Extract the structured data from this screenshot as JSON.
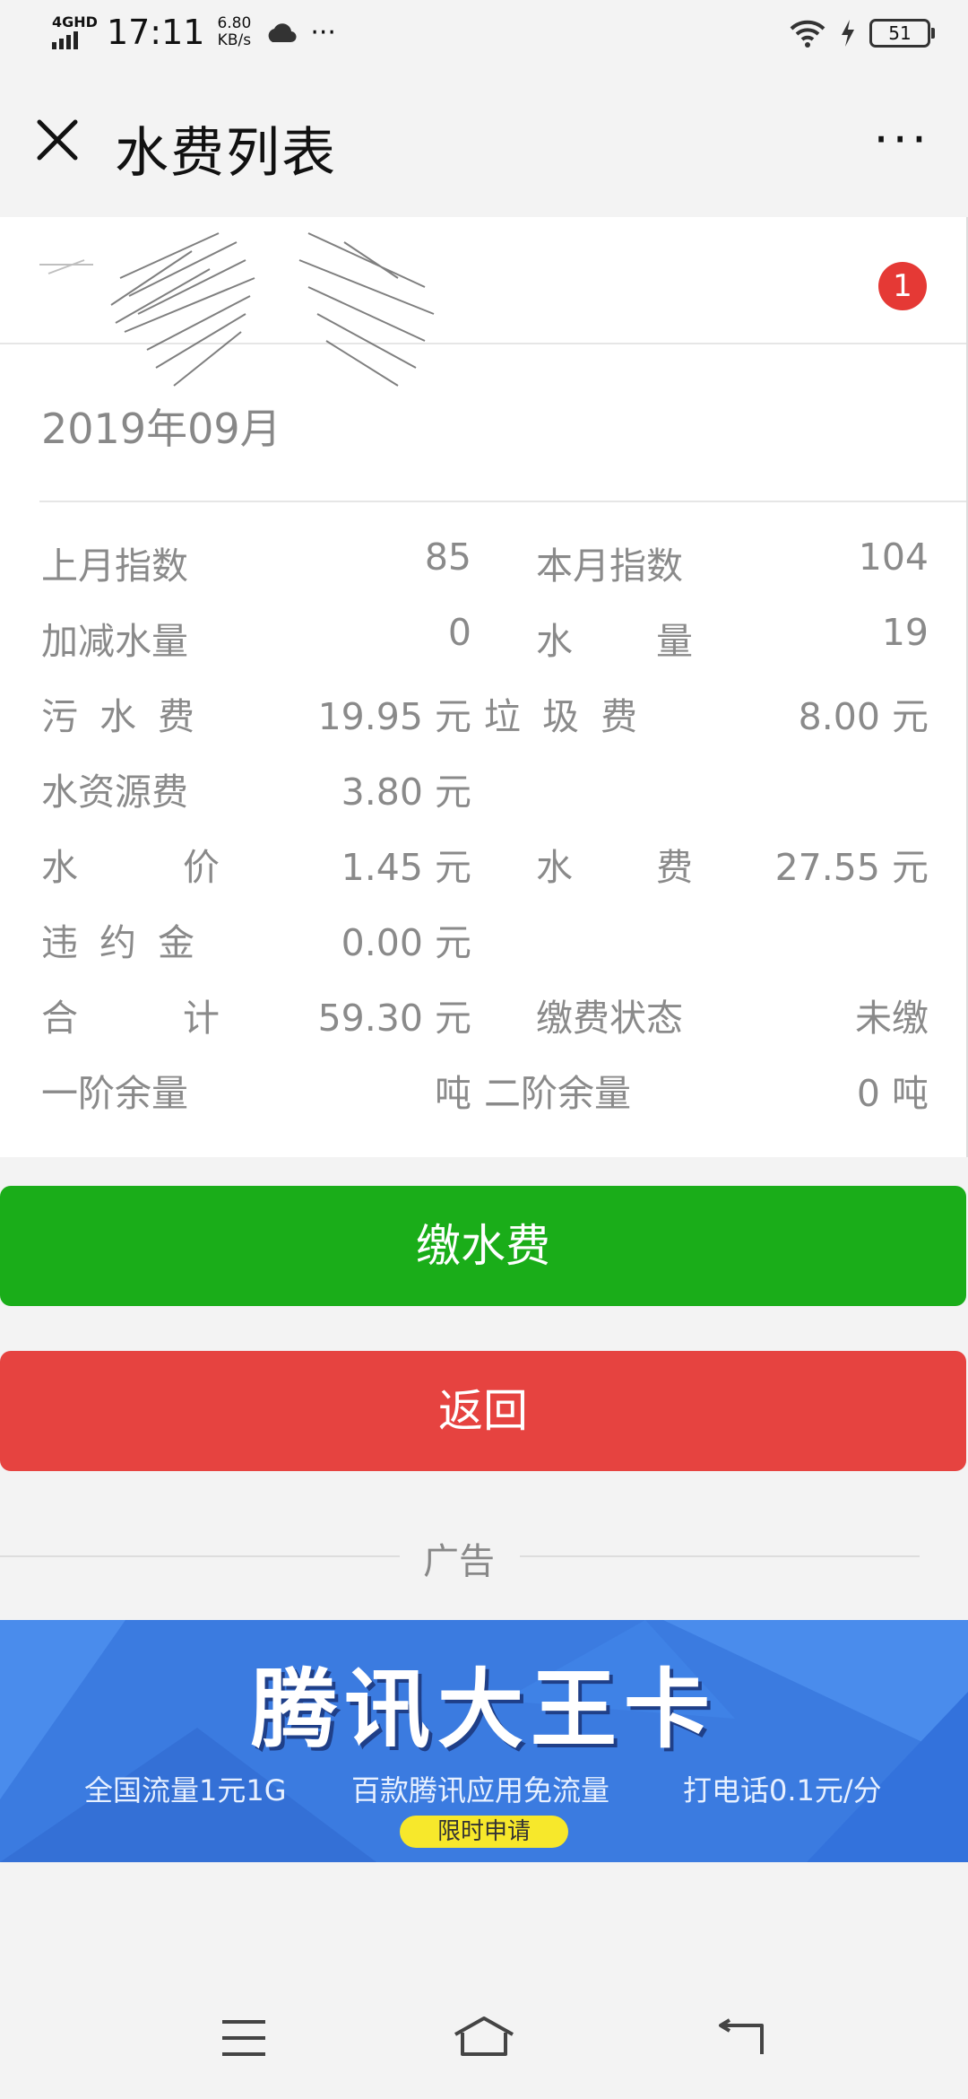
{
  "status_bar": {
    "network": "4GHD",
    "time": "17:11",
    "speed_value": "6.80",
    "speed_unit": "KB/s",
    "more": "···",
    "battery": "51"
  },
  "header": {
    "title": "水费列表",
    "more": "···"
  },
  "card": {
    "badge": "1",
    "month": "2019年09月",
    "rows": [
      {
        "l1": "上月指数",
        "v1": "85",
        "l2": "本月指数",
        "v2": "104"
      },
      {
        "l1": "加减水量",
        "v1": "0",
        "l2": "水　量",
        "v2": "19"
      },
      {
        "l1": "污水费",
        "v1": "19.95 元",
        "l2": "垃圾费",
        "v2": "8.00 元"
      },
      {
        "l1": "水资源费",
        "v1": "3.80 元",
        "l2": "",
        "v2": ""
      },
      {
        "l1": "水　价",
        "v1": "1.45 元",
        "l2": "水　费",
        "v2": "27.55 元"
      },
      {
        "l1": "违约金",
        "v1": "0.00 元",
        "l2": "",
        "v2": ""
      },
      {
        "l1": "合　计",
        "v1": "59.30 元",
        "l2": "缴费状态",
        "v2": "未缴"
      },
      {
        "l1": "一阶余量",
        "v1": "吨",
        "l2": "二阶余量",
        "v2": "0 吨"
      }
    ]
  },
  "buttons": {
    "pay": "缴水费",
    "back": "返回"
  },
  "ad": {
    "label": "广告",
    "title": "腾讯大王卡",
    "sub1": "全国流量1元1G",
    "sub2": "百款腾讯应用免流量",
    "sub3": "打电话0.1元/分",
    "cta": "限时申请"
  },
  "colors": {
    "pay_button": "#1aad19",
    "back_button": "#e64340",
    "badge": "#e53935",
    "ad_background": "#3b7be0"
  },
  "icons": [
    "signal-icon",
    "cloud-icon",
    "wifi-icon",
    "charging-icon",
    "battery-icon",
    "close-icon",
    "more-icon",
    "menu-icon",
    "home-icon",
    "back-icon"
  ]
}
